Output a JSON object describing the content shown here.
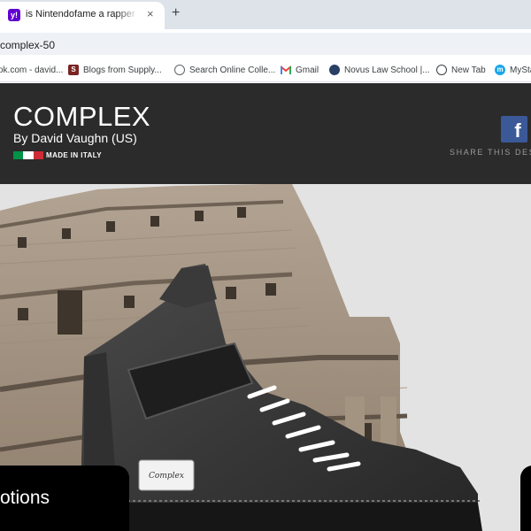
{
  "browser": {
    "tab": {
      "favicon": "yahoo-icon",
      "title": "is Nintendofame a rapper - Yahoo",
      "close": "×"
    },
    "new_tab": "+",
    "url": "complex-50",
    "bookmarks": [
      {
        "label": "ok.com - david...",
        "icon": "site-icon"
      },
      {
        "label": "Blogs from Supply...",
        "icon": "s-icon"
      },
      {
        "label": "Search Online Colle...",
        "icon": "search-icon"
      },
      {
        "label": "Gmail",
        "icon": "gmail-icon"
      },
      {
        "label": "Novus Law School |...",
        "icon": "novus-icon"
      },
      {
        "label": "New Tab",
        "icon": "globe-icon"
      },
      {
        "label": "MySta",
        "icon": "mystart-icon"
      }
    ]
  },
  "header": {
    "title": "COMPLEX",
    "designer": "By David Vaughn (US)",
    "made_in": "MADE IN ITALY",
    "share": "SHARE THIS DES",
    "facebook_glyph": "f"
  },
  "hero": {
    "options_label": "otions",
    "shoe_label": "Complex"
  },
  "colors": {
    "header_bg": "#2b2b2b",
    "facebook": "#3b5998",
    "flag_green": "#009246",
    "flag_white": "#ffffff",
    "flag_red": "#ce2b37"
  }
}
